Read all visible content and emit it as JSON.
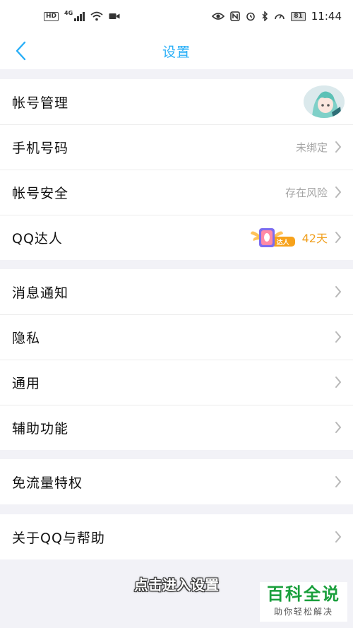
{
  "status_bar": {
    "hd": "HD",
    "network": "4G",
    "battery": "81",
    "time": "11:44"
  },
  "nav": {
    "title": "设置",
    "accent_color": "#27aef7"
  },
  "groups": [
    {
      "items": [
        {
          "label": "帐号管理",
          "right": "avatar"
        },
        {
          "label": "手机号码",
          "value": "未绑定"
        },
        {
          "label": "帐号安全",
          "value": "存在风险"
        },
        {
          "label": "QQ达人",
          "badge_text": "达人",
          "value": "42天",
          "value_color": "#f0a020"
        }
      ]
    },
    {
      "items": [
        {
          "label": "消息通知"
        },
        {
          "label": "隐私"
        },
        {
          "label": "通用"
        },
        {
          "label": "辅助功能"
        }
      ]
    },
    {
      "items": [
        {
          "label": "免流量特权"
        }
      ]
    },
    {
      "items": [
        {
          "label": "关于QQ与帮助"
        }
      ]
    }
  ],
  "caption": "点击进入设置",
  "watermark": {
    "title": "百科全说",
    "subtitle": "助你轻松解决"
  }
}
